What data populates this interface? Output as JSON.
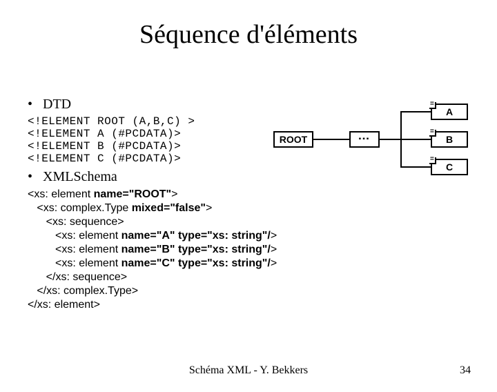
{
  "title": "Séquence d'éléments",
  "bullets": {
    "dtd": "DTD",
    "xmlschema": "XMLSchema"
  },
  "dtd_code": "<!ELEMENT ROOT (A,B,C) >\n<!ELEMENT A (#PCDATA)>\n<!ELEMENT B (#PCDATA)>\n<!ELEMENT C (#PCDATA)>",
  "xmls_lines": [
    {
      "indent": 0,
      "parts": [
        "<xs: element ",
        {
          "b": "name=\"ROOT\""
        },
        ">"
      ]
    },
    {
      "indent": 1,
      "parts": [
        "<xs: complex.Type ",
        {
          "b": "mixed=\"false\""
        },
        ">"
      ]
    },
    {
      "indent": 2,
      "parts": [
        "<xs: sequence>"
      ]
    },
    {
      "indent": 3,
      "parts": [
        "<xs: element ",
        {
          "b": "name=\"A\" type=\"xs: string\"/"
        },
        ">"
      ]
    },
    {
      "indent": 3,
      "parts": [
        "<xs: element ",
        {
          "b": "name=\"B\" type=\"xs: string\"/"
        },
        ">"
      ]
    },
    {
      "indent": 3,
      "parts": [
        "<xs: element ",
        {
          "b": "name=\"C\" type=\"xs: string\"/"
        },
        ">"
      ]
    },
    {
      "indent": 2,
      "parts": [
        "</xs: sequence>"
      ]
    },
    {
      "indent": 1,
      "parts": [
        "</xs: complex.Type>"
      ]
    },
    {
      "indent": 0,
      "parts": [
        "</xs: element>"
      ]
    }
  ],
  "diagram": {
    "root": "ROOT",
    "leaves": [
      "A",
      "B",
      "C"
    ]
  },
  "footer": {
    "center": "Schéma XML - Y. Bekkers",
    "page": "34"
  }
}
